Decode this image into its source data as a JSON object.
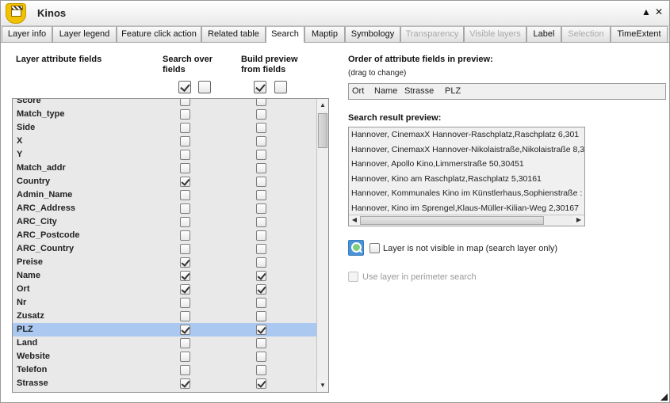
{
  "window": {
    "title": "Kinos"
  },
  "tabs": [
    {
      "label": "Layer info",
      "state": "normal"
    },
    {
      "label": "Layer legend",
      "state": "normal"
    },
    {
      "label": "Feature click action",
      "state": "normal"
    },
    {
      "label": "Related table",
      "state": "normal"
    },
    {
      "label": "Search",
      "state": "active"
    },
    {
      "label": "Maptip",
      "state": "normal"
    },
    {
      "label": "Symbology",
      "state": "normal"
    },
    {
      "label": "Transparency",
      "state": "disabled"
    },
    {
      "label": "Visible layers",
      "state": "disabled"
    },
    {
      "label": "Label",
      "state": "normal"
    },
    {
      "label": "Selection",
      "state": "disabled"
    },
    {
      "label": "TimeExtent",
      "state": "normal"
    }
  ],
  "fields_panel": {
    "header_fields": "Layer attribute fields",
    "header_search": "Search over fields",
    "header_preview": "Build preview from fields"
  },
  "fields": [
    {
      "name": "Score",
      "search": false,
      "preview": false
    },
    {
      "name": "Match_type",
      "search": false,
      "preview": false
    },
    {
      "name": "Side",
      "search": false,
      "preview": false
    },
    {
      "name": "X",
      "search": false,
      "preview": false
    },
    {
      "name": "Y",
      "search": false,
      "preview": false
    },
    {
      "name": "Match_addr",
      "search": false,
      "preview": false
    },
    {
      "name": "Country",
      "search": true,
      "preview": false
    },
    {
      "name": "Admin_Name",
      "search": false,
      "preview": false
    },
    {
      "name": "ARC_Address",
      "search": false,
      "preview": false
    },
    {
      "name": "ARC_City",
      "search": false,
      "preview": false
    },
    {
      "name": "ARC_Postcode",
      "search": false,
      "preview": false
    },
    {
      "name": "ARC_Country",
      "search": false,
      "preview": false
    },
    {
      "name": "Preise",
      "search": true,
      "preview": false
    },
    {
      "name": "Name",
      "search": true,
      "preview": true
    },
    {
      "name": "Ort",
      "search": true,
      "preview": true
    },
    {
      "name": "Nr",
      "search": false,
      "preview": false
    },
    {
      "name": "Zusatz",
      "search": false,
      "preview": false
    },
    {
      "name": "PLZ",
      "search": true,
      "preview": true,
      "selected": true
    },
    {
      "name": "Land",
      "search": false,
      "preview": false
    },
    {
      "name": "Website",
      "search": false,
      "preview": false
    },
    {
      "name": "Telefon",
      "search": false,
      "preview": false
    },
    {
      "name": "Strasse",
      "search": true,
      "preview": true
    }
  ],
  "order": {
    "title": "Order of attribute fields in preview:",
    "hint": "(drag to change)",
    "items": [
      "Ort",
      "Name",
      "Strasse",
      "PLZ"
    ]
  },
  "preview": {
    "title": "Search result preview:",
    "lines": [
      "Hannover, CinemaxX Hannover-Raschplatz,Raschplatz 6,301",
      "Hannover, CinemaxX Hannover-Nikolaistraße,Nikolaistraße 8,3",
      "Hannover, Apollo Kino,Limmerstraße 50,30451",
      "Hannover, Kino am Raschplatz,Raschplatz 5,30161",
      "Hannover, Kommunales Kino im Künstlerhaus,Sophienstraße :",
      "Hannover, Kino im Sprengel,Klaus-Müller-Kilian-Weg 2,30167"
    ]
  },
  "options": {
    "not_visible_label": "Layer is not visible in map (search layer only)",
    "perimeter_label": "Use layer in perimeter search"
  },
  "icons": {
    "minimize": "triangle-up",
    "close": "x",
    "app": "clapperboard-marker",
    "search_layer": "magnifier"
  }
}
